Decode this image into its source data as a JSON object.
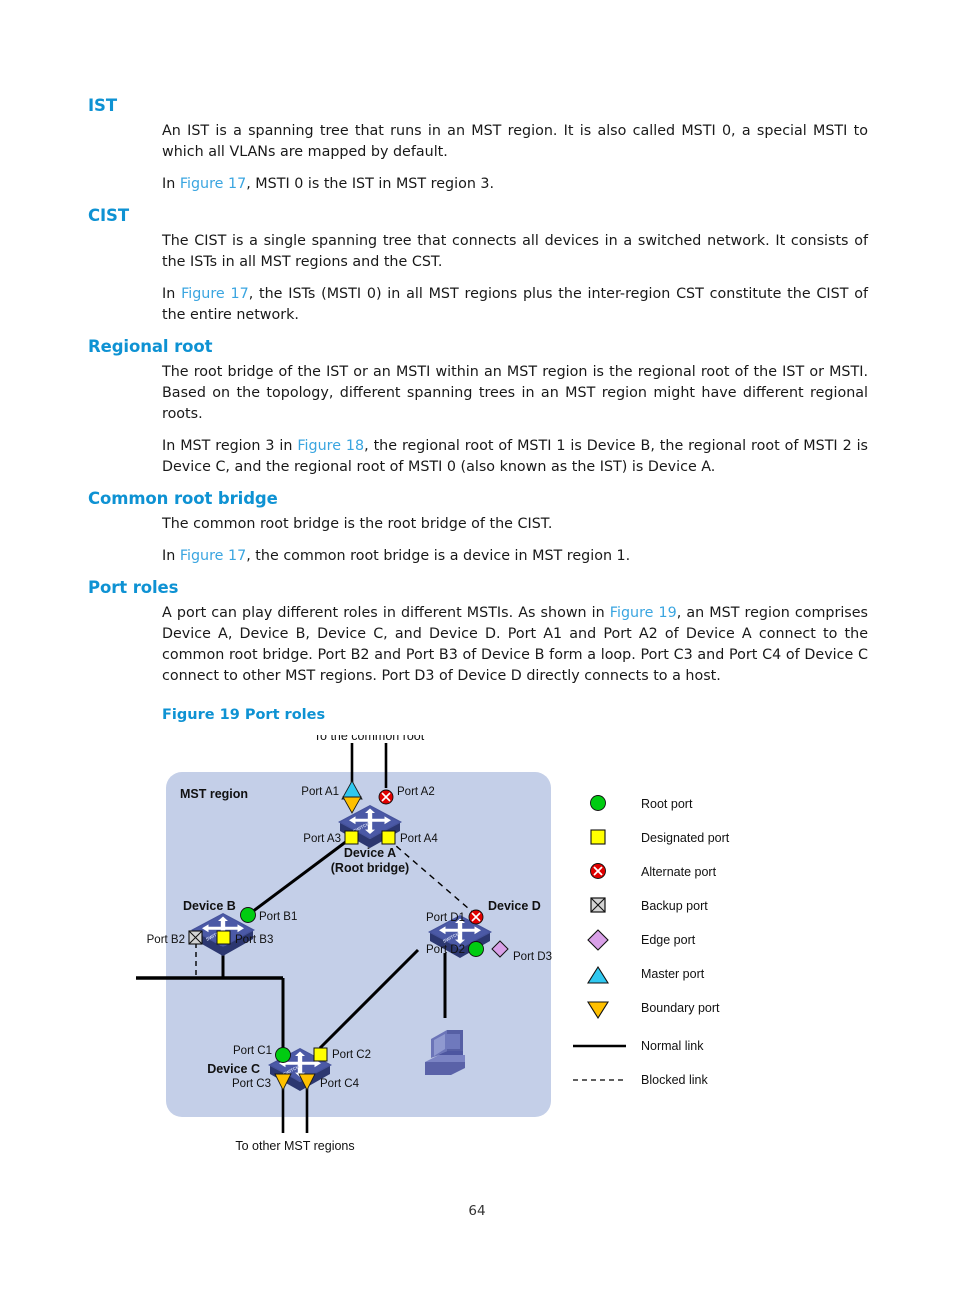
{
  "document": {
    "page_number": "64"
  },
  "sections": [
    {
      "heading": "IST",
      "paragraphs": [
        "An IST is a spanning tree that runs in an MST region. It is also called MSTI 0, a special MSTI to which all VLANs are mapped by default.",
        "In Figure 17, MSTI 0 is the IST in MST region 3."
      ]
    },
    {
      "heading": "CIST",
      "paragraphs": [
        "The CIST is a single spanning tree that connects all devices in a switched network. It consists of the ISTs in all MST regions and the CST.",
        "In Figure 17, the ISTs (MSTI 0) in all MST regions plus the inter-region CST constitute the CIST of the entire network."
      ]
    },
    {
      "heading": "Regional root",
      "paragraphs": [
        "The root bridge of the IST or an MSTI within an MST region is the regional root of the IST or MSTI. Based on the topology, different spanning trees in an MST region might have different regional roots.",
        "In MST region 3 in Figure 18, the regional root of MSTI 1 is Device B, the regional root of MSTI 2 is Device C, and the regional root of MSTI 0 (also known as the IST) is Device A."
      ]
    },
    {
      "heading": "Common root bridge",
      "paragraphs": [
        "The common root bridge is the root bridge of the CIST.",
        "In Figure 17, the common root bridge is a device in MST region 1."
      ]
    },
    {
      "heading": "Port roles",
      "paragraphs": [
        "A port can play different roles in different MSTIs. As shown in Figure 19, an MST region comprises Device A, Device B, Device C, and Device D. Port A1 and Port A2 of Device A connect to the common root bridge. Port B2 and Port B3 of Device B form a loop. Port C3 and Port C4 of Device C connect to other MST regions. Port D3 of Device D directly connects to a host."
      ]
    }
  ],
  "xrefs": {
    "fig17": "Figure 17",
    "fig18": "Figure 18",
    "fig19": "Figure 19"
  },
  "figure": {
    "caption": "Figure 19 Port roles",
    "region_label": "MST region",
    "top_annotation": "To the common root",
    "bottom_annotation": "To other MST regions",
    "devices": [
      {
        "id": "a",
        "name": "Device A",
        "subtitle": "(Root bridge)"
      },
      {
        "id": "b",
        "name": "Device B",
        "subtitle": ""
      },
      {
        "id": "c",
        "name": "Device C",
        "subtitle": ""
      },
      {
        "id": "d",
        "name": "Device D",
        "subtitle": ""
      }
    ],
    "ports": [
      {
        "id": "a1",
        "label": "Port A1",
        "role": "master+boundary"
      },
      {
        "id": "a2",
        "label": "Port A2",
        "role": "alternate"
      },
      {
        "id": "a3",
        "label": "Port A3",
        "role": "designated"
      },
      {
        "id": "a4",
        "label": "Port A4",
        "role": "designated"
      },
      {
        "id": "b1",
        "label": "Port B1",
        "role": "root"
      },
      {
        "id": "b2",
        "label": "Port B2",
        "role": "backup"
      },
      {
        "id": "b3",
        "label": "Port B3",
        "role": "designated"
      },
      {
        "id": "c1",
        "label": "Port C1",
        "role": "root"
      },
      {
        "id": "c2",
        "label": "Port C2",
        "role": "designated"
      },
      {
        "id": "c3",
        "label": "Port C3",
        "role": "boundary"
      },
      {
        "id": "c4",
        "label": "Port C4",
        "role": "boundary"
      },
      {
        "id": "d1",
        "label": "Port D1",
        "role": "alternate"
      },
      {
        "id": "d2",
        "label": "Port D2",
        "role": "root"
      },
      {
        "id": "d3",
        "label": "Port D3",
        "role": "edge"
      }
    ],
    "legend": [
      {
        "key": "root",
        "label": "Root port",
        "symbol": "circle",
        "color": "#00cc11"
      },
      {
        "key": "designated",
        "label": "Designated port",
        "symbol": "square",
        "color": "#ffff00"
      },
      {
        "key": "alternate",
        "label": "Alternate port",
        "symbol": "circle-x",
        "color": "#e00000"
      },
      {
        "key": "backup",
        "label": "Backup port",
        "symbol": "square-x",
        "color": "#cccccc"
      },
      {
        "key": "edge",
        "label": "Edge port",
        "symbol": "diamond",
        "color": "#d9a0e8"
      },
      {
        "key": "master",
        "label": "Master port",
        "symbol": "triangle-up",
        "color": "#30c8f0"
      },
      {
        "key": "boundary",
        "label": "Boundary port",
        "symbol": "triangle-down",
        "color": "#ffc000"
      },
      {
        "key": "normal-link",
        "label": "Normal link",
        "symbol": "solid-line",
        "color": "#000000"
      },
      {
        "key": "blocked-link",
        "label": "Blocked link",
        "symbol": "dashed-line",
        "color": "#000000"
      }
    ],
    "colors": {
      "region_fill": "#c4cfe8",
      "device_body": "#3c4a8e",
      "device_top": "#4a5aa8",
      "host_body": "#6b73b8",
      "link": "#000000"
    }
  }
}
